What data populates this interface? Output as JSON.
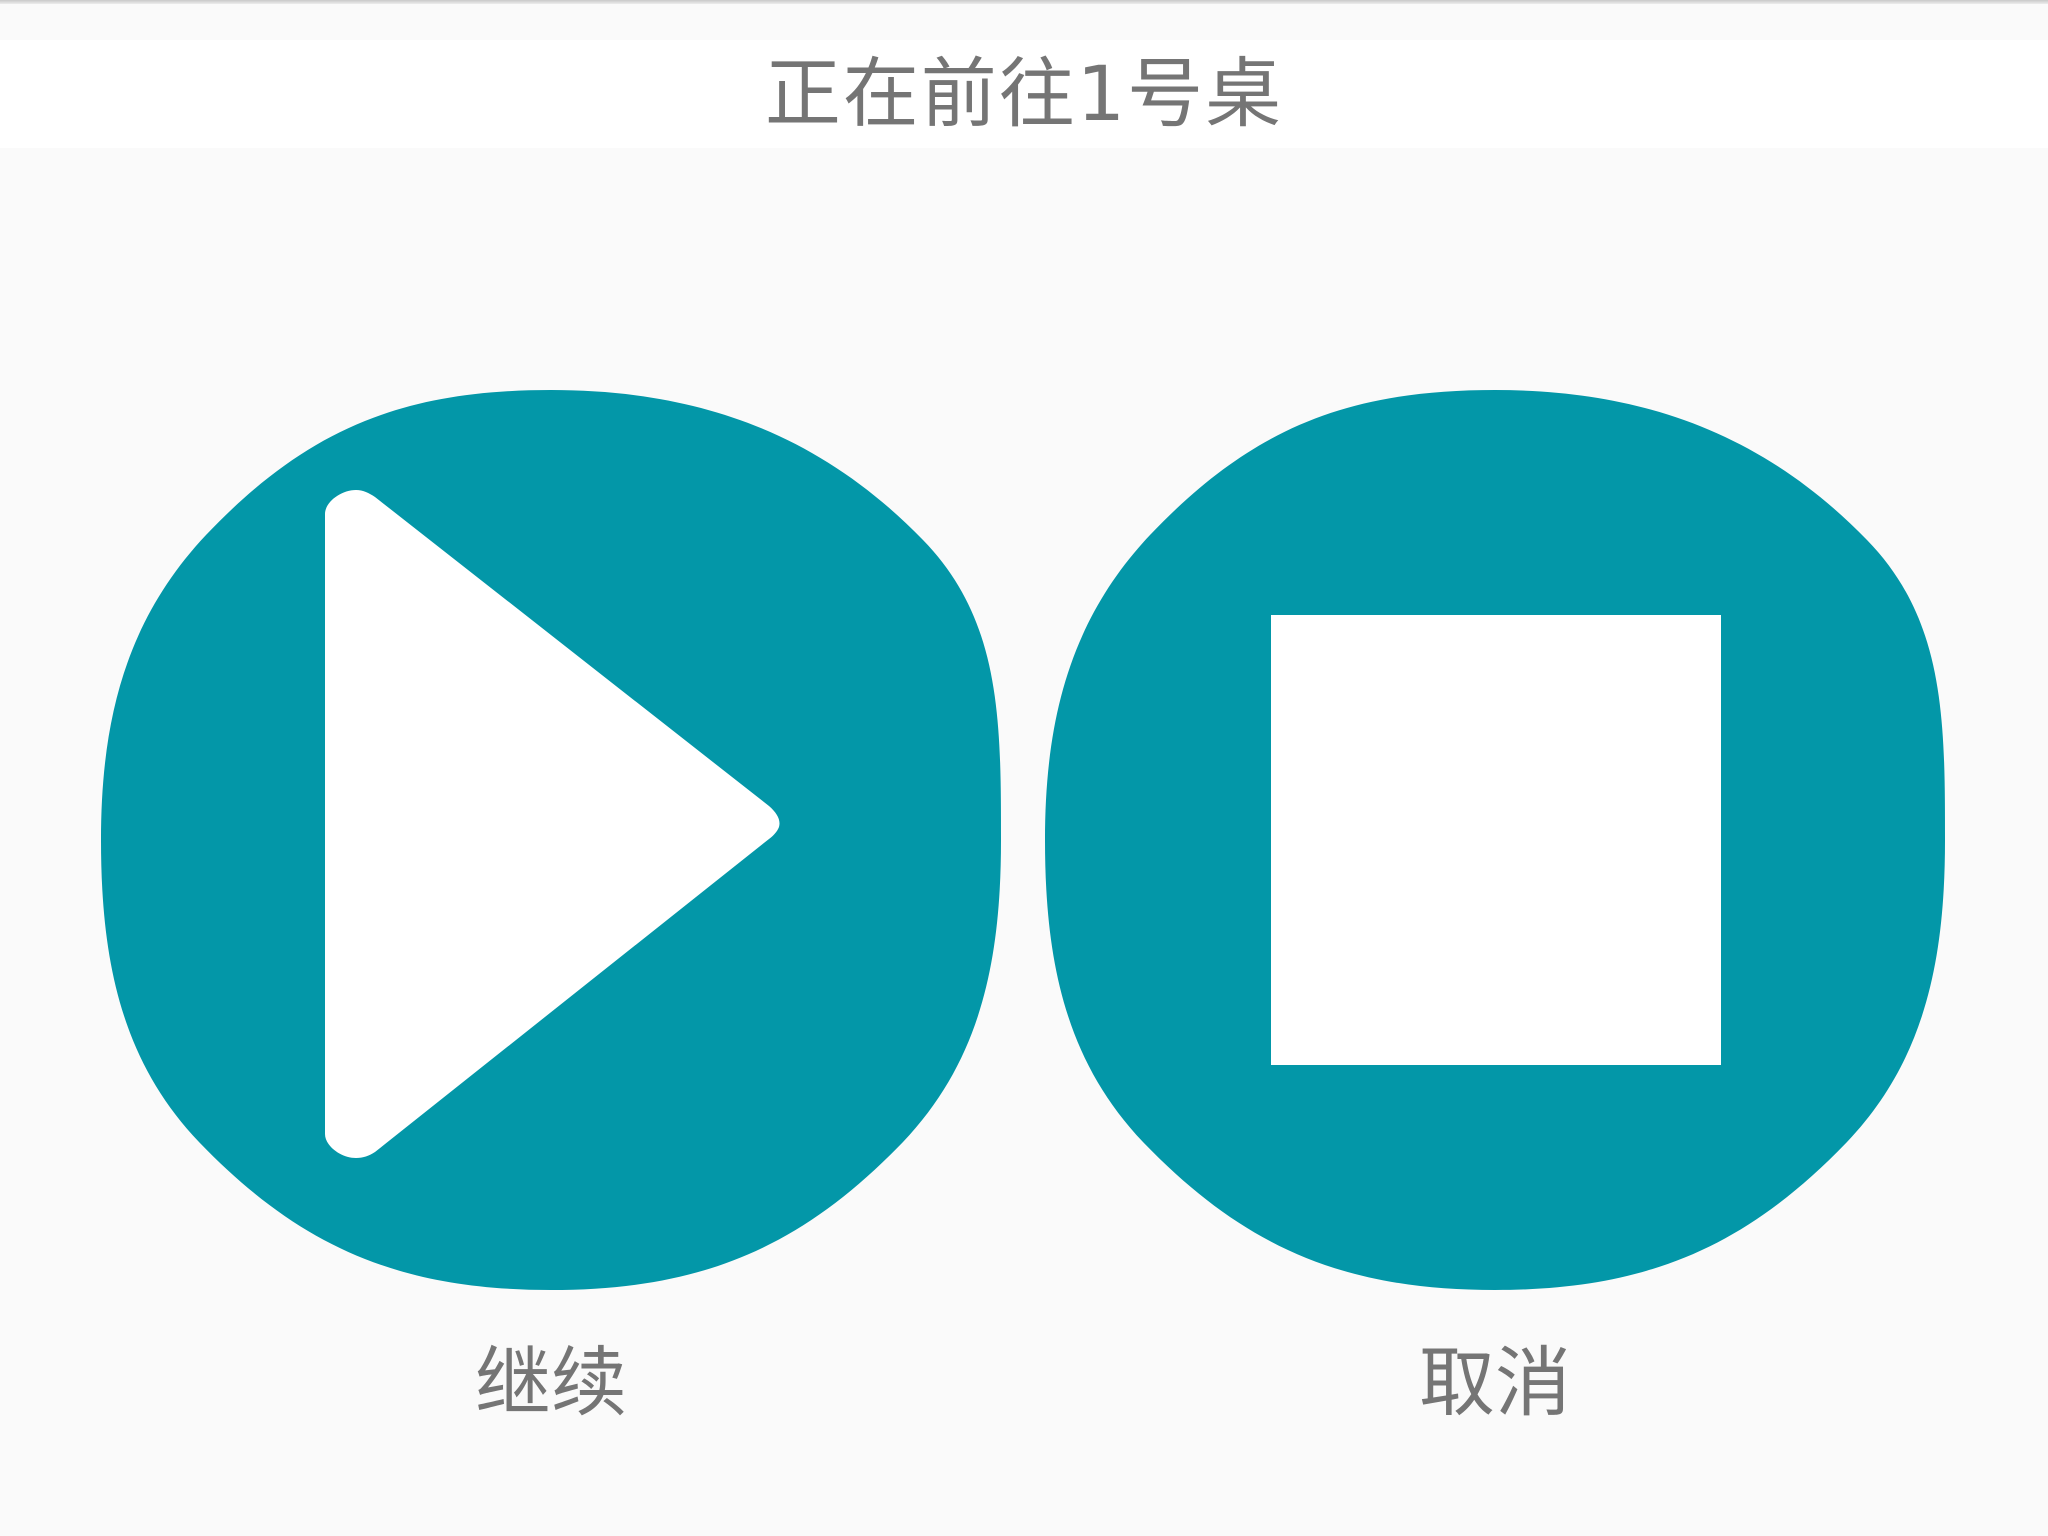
{
  "header": {
    "title": "正在前往1号桌"
  },
  "actions": {
    "continue": {
      "label": "继续",
      "icon": "play-icon"
    },
    "cancel": {
      "label": "取消",
      "icon": "stop-icon"
    }
  },
  "colors": {
    "accent": "#0397a8",
    "icon_fill": "#ffffff",
    "text": "#757575",
    "background": "#fafafa",
    "header_background": "#ffffff"
  }
}
